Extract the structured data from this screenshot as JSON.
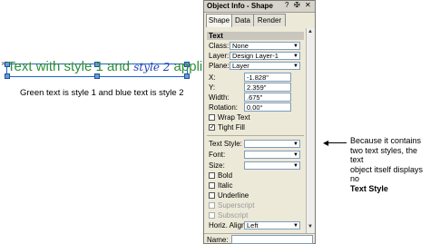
{
  "illustration": {
    "text_green": "Text with style 1 and ",
    "text_blue": "style 2",
    "text_green_end": " applied",
    "caption": "Green text is style 1 and blue text is style 2",
    "colors": {
      "green": "#2e8f3a",
      "blue": "#1f3fb3",
      "selection": "#1e63c8"
    }
  },
  "palette": {
    "title": "Object Info - Shape",
    "title_icons": [
      "?",
      "✠",
      "✕"
    ],
    "tabs": [
      {
        "label": "Shape",
        "active": true
      },
      {
        "label": "Data",
        "active": false
      },
      {
        "label": "Render",
        "active": false
      }
    ],
    "section": "Text",
    "class_label": "Class:",
    "class_value": "None",
    "layer_label": "Layer:",
    "layer_value": "Design Layer-1",
    "plane_label": "Plane:",
    "plane_value": "Layer",
    "x_label": "X:",
    "x_value": "-1.828\"",
    "y_label": "Y:",
    "y_value": "2.359\"",
    "width_label": "Width:",
    "width_value": ".675\"",
    "rotation_label": "Rotation:",
    "rotation_value": "0.00°",
    "wrap_text": {
      "label": "Wrap Text",
      "checked": false
    },
    "tight_fill": {
      "label": "Tight Fill",
      "checked": true
    },
    "text_style_label": "Text Style:",
    "text_style_value": "",
    "font_label": "Font:",
    "font_value": "",
    "size_label": "Size:",
    "size_value": "",
    "bold": {
      "label": "Bold",
      "checked": false
    },
    "italic": {
      "label": "Italic",
      "checked": false
    },
    "underline": {
      "label": "Underline",
      "checked": false
    },
    "superscript": {
      "label": "Superscript",
      "checked": false,
      "disabled": true
    },
    "subscript": {
      "label": "Subscript",
      "checked": false,
      "disabled": true
    },
    "horiz_align_label": "Horiz. Align:",
    "horiz_align_value": "Left",
    "name_label": "Name:",
    "name_value": ""
  },
  "annotation": {
    "line1": "Because it contains",
    "line2": "two text styles, the text",
    "line3": "object itself displays no",
    "line4_bold": "Text Style"
  }
}
